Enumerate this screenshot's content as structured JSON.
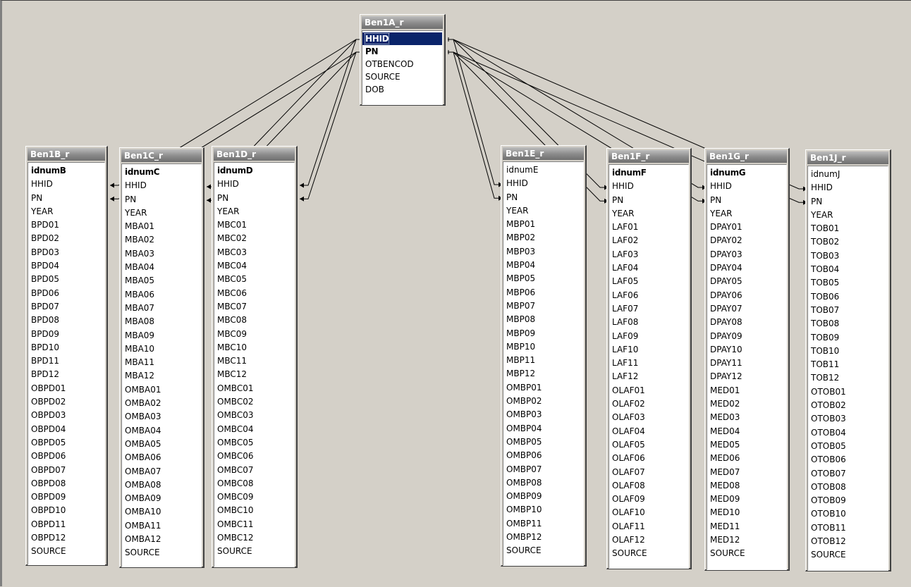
{
  "tables": [
    {
      "id": "ben1a",
      "title": "Ben1A_r",
      "fields": [
        {
          "name": "HHID",
          "key": true,
          "selected": true
        },
        {
          "name": "PN",
          "key": true
        },
        {
          "name": "OTBENCOD"
        },
        {
          "name": "SOURCE"
        },
        {
          "name": "DOB"
        }
      ]
    },
    {
      "id": "ben1b",
      "title": "Ben1B_r",
      "fields": [
        {
          "name": "idnumB",
          "key": true
        },
        {
          "name": "HHID"
        },
        {
          "name": "PN"
        },
        {
          "name": "YEAR"
        },
        {
          "name": "BPD01"
        },
        {
          "name": "BPD02"
        },
        {
          "name": "BPD03"
        },
        {
          "name": "BPD04"
        },
        {
          "name": "BPD05"
        },
        {
          "name": "BPD06"
        },
        {
          "name": "BPD07"
        },
        {
          "name": "BPD08"
        },
        {
          "name": "BPD09"
        },
        {
          "name": "BPD10"
        },
        {
          "name": "BPD11"
        },
        {
          "name": "BPD12"
        },
        {
          "name": "OBPD01"
        },
        {
          "name": "OBPD02"
        },
        {
          "name": "OBPD03"
        },
        {
          "name": "OBPD04"
        },
        {
          "name": "OBPD05"
        },
        {
          "name": "OBPD06"
        },
        {
          "name": "OBPD07"
        },
        {
          "name": "OBPD08"
        },
        {
          "name": "OBPD09"
        },
        {
          "name": "OBPD10"
        },
        {
          "name": "OBPD11"
        },
        {
          "name": "OBPD12"
        },
        {
          "name": "SOURCE"
        }
      ]
    },
    {
      "id": "ben1c",
      "title": "Ben1C_r",
      "fields": [
        {
          "name": "idnumC",
          "key": true
        },
        {
          "name": "HHID"
        },
        {
          "name": "PN"
        },
        {
          "name": "YEAR"
        },
        {
          "name": "MBA01"
        },
        {
          "name": "MBA02"
        },
        {
          "name": "MBA03"
        },
        {
          "name": "MBA04"
        },
        {
          "name": "MBA05"
        },
        {
          "name": "MBA06"
        },
        {
          "name": "MBA07"
        },
        {
          "name": "MBA08"
        },
        {
          "name": "MBA09"
        },
        {
          "name": "MBA10"
        },
        {
          "name": "MBA11"
        },
        {
          "name": "MBA12"
        },
        {
          "name": "OMBA01"
        },
        {
          "name": "OMBA02"
        },
        {
          "name": "OMBA03"
        },
        {
          "name": "OMBA04"
        },
        {
          "name": "OMBA05"
        },
        {
          "name": "OMBA06"
        },
        {
          "name": "OMBA07"
        },
        {
          "name": "OMBA08"
        },
        {
          "name": "OMBA09"
        },
        {
          "name": "OMBA10"
        },
        {
          "name": "OMBA11"
        },
        {
          "name": "OMBA12"
        },
        {
          "name": "SOURCE"
        }
      ]
    },
    {
      "id": "ben1d",
      "title": "Ben1D_r",
      "fields": [
        {
          "name": "idnumD",
          "key": true
        },
        {
          "name": "HHID"
        },
        {
          "name": "PN"
        },
        {
          "name": "YEAR"
        },
        {
          "name": "MBC01"
        },
        {
          "name": "MBC02"
        },
        {
          "name": "MBC03"
        },
        {
          "name": "MBC04"
        },
        {
          "name": "MBC05"
        },
        {
          "name": "MBC06"
        },
        {
          "name": "MBC07"
        },
        {
          "name": "MBC08"
        },
        {
          "name": "MBC09"
        },
        {
          "name": "MBC10"
        },
        {
          "name": "MBC11"
        },
        {
          "name": "MBC12"
        },
        {
          "name": "OMBC01"
        },
        {
          "name": "OMBC02"
        },
        {
          "name": "OMBC03"
        },
        {
          "name": "OMBC04"
        },
        {
          "name": "OMBC05"
        },
        {
          "name": "OMBC06"
        },
        {
          "name": "OMBC07"
        },
        {
          "name": "OMBC08"
        },
        {
          "name": "OMBC09"
        },
        {
          "name": "OMBC10"
        },
        {
          "name": "OMBC11"
        },
        {
          "name": "OMBC12"
        },
        {
          "name": "SOURCE"
        }
      ]
    },
    {
      "id": "ben1e",
      "title": "Ben1E_r",
      "fields": [
        {
          "name": "idnumE"
        },
        {
          "name": "HHID"
        },
        {
          "name": "PN"
        },
        {
          "name": "YEAR"
        },
        {
          "name": "MBP01"
        },
        {
          "name": "MBP02"
        },
        {
          "name": "MBP03"
        },
        {
          "name": "MBP04"
        },
        {
          "name": "MBP05"
        },
        {
          "name": "MBP06"
        },
        {
          "name": "MBP07"
        },
        {
          "name": "MBP08"
        },
        {
          "name": "MBP09"
        },
        {
          "name": "MBP10"
        },
        {
          "name": "MBP11"
        },
        {
          "name": "MBP12"
        },
        {
          "name": "OMBP01"
        },
        {
          "name": "OMBP02"
        },
        {
          "name": "OMBP03"
        },
        {
          "name": "OMBP04"
        },
        {
          "name": "OMBP05"
        },
        {
          "name": "OMBP06"
        },
        {
          "name": "OMBP07"
        },
        {
          "name": "OMBP08"
        },
        {
          "name": "OMBP09"
        },
        {
          "name": "OMBP10"
        },
        {
          "name": "OMBP11"
        },
        {
          "name": "OMBP12"
        },
        {
          "name": "SOURCE"
        }
      ]
    },
    {
      "id": "ben1f",
      "title": "Ben1F_r",
      "fields": [
        {
          "name": "idnumF",
          "key": true
        },
        {
          "name": "HHID"
        },
        {
          "name": "PN"
        },
        {
          "name": "YEAR"
        },
        {
          "name": "LAF01"
        },
        {
          "name": "LAF02"
        },
        {
          "name": "LAF03"
        },
        {
          "name": "LAF04"
        },
        {
          "name": "LAF05"
        },
        {
          "name": "LAF06"
        },
        {
          "name": "LAF07"
        },
        {
          "name": "LAF08"
        },
        {
          "name": "LAF09"
        },
        {
          "name": "LAF10"
        },
        {
          "name": "LAF11"
        },
        {
          "name": "LAF12"
        },
        {
          "name": "OLAF01"
        },
        {
          "name": "OLAF02"
        },
        {
          "name": "OLAF03"
        },
        {
          "name": "OLAF04"
        },
        {
          "name": "OLAF05"
        },
        {
          "name": "OLAF06"
        },
        {
          "name": "OLAF07"
        },
        {
          "name": "OLAF08"
        },
        {
          "name": "OLAF09"
        },
        {
          "name": "OLAF10"
        },
        {
          "name": "OLAF11"
        },
        {
          "name": "OLAF12"
        },
        {
          "name": "SOURCE"
        }
      ]
    },
    {
      "id": "ben1g",
      "title": "Ben1G_r",
      "fields": [
        {
          "name": "idnumG",
          "key": true
        },
        {
          "name": "HHID"
        },
        {
          "name": "PN"
        },
        {
          "name": "YEAR"
        },
        {
          "name": "DPAY01"
        },
        {
          "name": "DPAY02"
        },
        {
          "name": "DPAY03"
        },
        {
          "name": "DPAY04"
        },
        {
          "name": "DPAY05"
        },
        {
          "name": "DPAY06"
        },
        {
          "name": "DPAY07"
        },
        {
          "name": "DPAY08"
        },
        {
          "name": "DPAY09"
        },
        {
          "name": "DPAY10"
        },
        {
          "name": "DPAY11"
        },
        {
          "name": "DPAY12"
        },
        {
          "name": "MED01"
        },
        {
          "name": "MED02"
        },
        {
          "name": "MED03"
        },
        {
          "name": "MED04"
        },
        {
          "name": "MED05"
        },
        {
          "name": "MED06"
        },
        {
          "name": "MED07"
        },
        {
          "name": "MED08"
        },
        {
          "name": "MED09"
        },
        {
          "name": "MED10"
        },
        {
          "name": "MED11"
        },
        {
          "name": "MED12"
        },
        {
          "name": "SOURCE"
        }
      ]
    },
    {
      "id": "ben1j",
      "title": "Ben1J_r",
      "fields": [
        {
          "name": "idnumJ"
        },
        {
          "name": "HHID"
        },
        {
          "name": "PN"
        },
        {
          "name": "YEAR"
        },
        {
          "name": "TOB01"
        },
        {
          "name": "TOB02"
        },
        {
          "name": "TOB03"
        },
        {
          "name": "TOB04"
        },
        {
          "name": "TOB05"
        },
        {
          "name": "TOB06"
        },
        {
          "name": "TOB07"
        },
        {
          "name": "TOB08"
        },
        {
          "name": "TOB09"
        },
        {
          "name": "TOB10"
        },
        {
          "name": "TOB11"
        },
        {
          "name": "TOB12"
        },
        {
          "name": "OTOB01"
        },
        {
          "name": "OTOB02"
        },
        {
          "name": "OTOB03"
        },
        {
          "name": "OTOB04"
        },
        {
          "name": "OTOB05"
        },
        {
          "name": "OTOB06"
        },
        {
          "name": "OTOB07"
        },
        {
          "name": "OTOB08"
        },
        {
          "name": "OTOB09"
        },
        {
          "name": "OTOB10"
        },
        {
          "name": "OTOB11"
        },
        {
          "name": "OTOB12"
        },
        {
          "name": "SOURCE"
        }
      ]
    }
  ],
  "relationships": [
    {
      "from": "ben1a",
      "to": "ben1b",
      "fields": [
        "HHID",
        "PN"
      ]
    },
    {
      "from": "ben1a",
      "to": "ben1c",
      "fields": [
        "HHID",
        "PN"
      ]
    },
    {
      "from": "ben1a",
      "to": "ben1d",
      "fields": [
        "HHID",
        "PN"
      ]
    },
    {
      "from": "ben1a",
      "to": "ben1e",
      "fields": [
        "HHID",
        "PN"
      ]
    },
    {
      "from": "ben1a",
      "to": "ben1f",
      "fields": [
        "HHID",
        "PN"
      ]
    },
    {
      "from": "ben1a",
      "to": "ben1g",
      "fields": [
        "HHID",
        "PN"
      ]
    },
    {
      "from": "ben1a",
      "to": "ben1j",
      "fields": [
        "HHID",
        "PN"
      ]
    }
  ],
  "colors": {
    "workspace": "#d4d0c8",
    "title_bar": "#8a8a8a",
    "selection": "#0a246a",
    "line": "#000000"
  }
}
